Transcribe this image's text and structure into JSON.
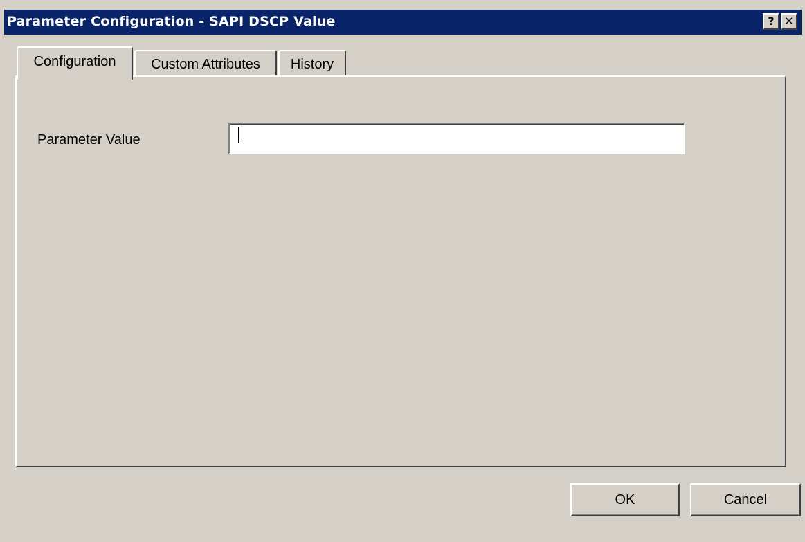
{
  "window": {
    "title": "Parameter Configuration - SAPI DSCP Value",
    "help_button": "?",
    "close_button": "✕",
    "accent_color": "#0a246a",
    "background_color": "#d4d0c8"
  },
  "tabs": [
    {
      "label": "Configuration",
      "active": true
    },
    {
      "label": "Custom Attributes",
      "active": false
    },
    {
      "label": "History",
      "active": false
    }
  ],
  "form": {
    "parameter_value_label": "Parameter Value",
    "parameter_value": ""
  },
  "buttons": {
    "ok_label": "OK",
    "cancel_label": "Cancel"
  }
}
